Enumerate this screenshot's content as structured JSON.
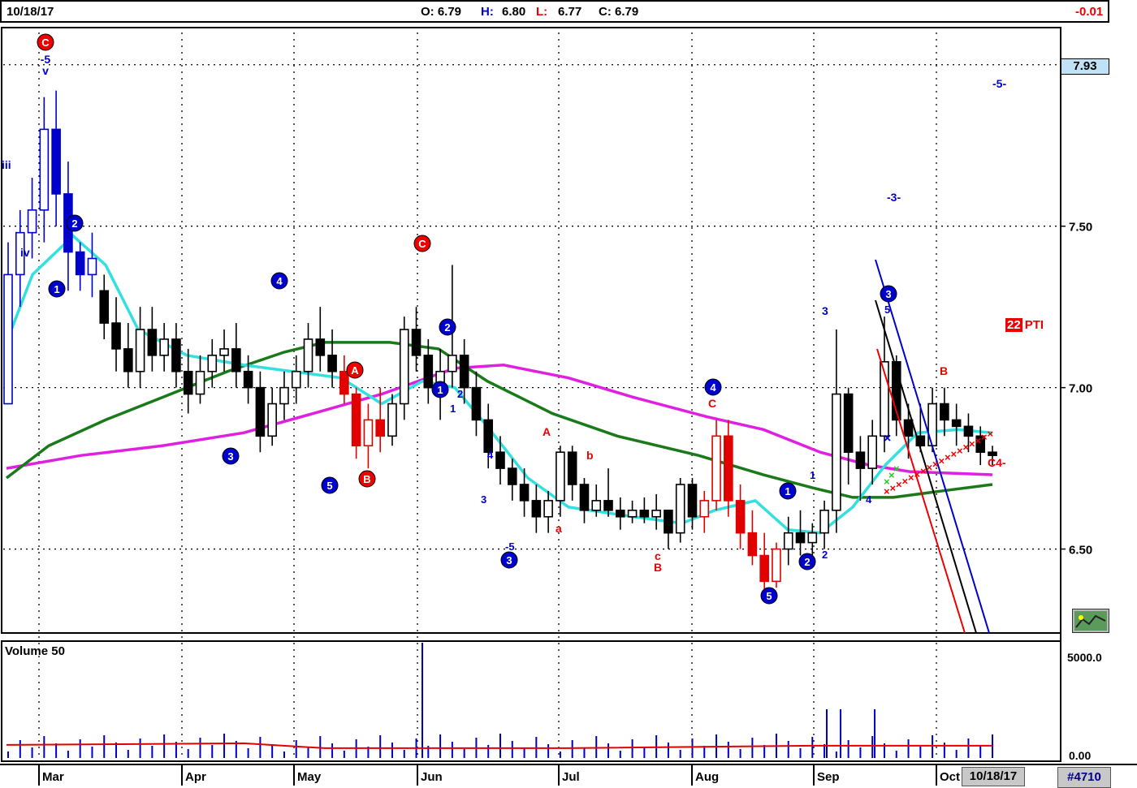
{
  "header": {
    "date": "10/18/17",
    "open": "O: 6.79",
    "high_label": "H:",
    "high_val": "6.80",
    "low_label": "L:",
    "low_val": "6.77",
    "close": "C: 6.79",
    "change": "-0.01"
  },
  "volume_label": "Volume 50",
  "current_price_tag": "7.93",
  "pti": {
    "value": "22",
    "label": "PTI"
  },
  "footer": {
    "date": "10/18/17",
    "symbol_id": "#4710"
  },
  "months": [
    "Mar",
    "Apr",
    "May",
    "Jun",
    "Jul",
    "Aug",
    "Sep",
    "Oct"
  ],
  "colors": {
    "up_wave": "#0000cc",
    "down_wave": "#e00000",
    "ma_fast": "#33e0e0",
    "ma_mid": "#1a7a1a",
    "ma_slow": "#e020e0",
    "volume_ma": "#e00000"
  },
  "chart_data": {
    "type": "candlestick",
    "y_ticks": [
      "8.00",
      "7.50",
      "7.00",
      "6.50"
    ],
    "ylim": [
      6.24,
      8.1
    ],
    "volume_ticks": [
      "5000.0",
      "0.00"
    ],
    "grid": "dotted horizontal and vertical",
    "wave_labels": [
      {
        "text": "-5",
        "color": "blue"
      },
      {
        "text": "v",
        "color": "blue"
      },
      {
        "text": "iii",
        "color": "blue"
      },
      {
        "text": "iv",
        "color": "blue"
      },
      {
        "text": "1",
        "color": "blue",
        "circled": true
      },
      {
        "text": "2",
        "color": "blue",
        "circled": true
      },
      {
        "text": "3",
        "color": "blue",
        "circled": true
      },
      {
        "text": "4",
        "color": "blue",
        "circled": true
      },
      {
        "text": "5",
        "color": "blue",
        "circled": true
      },
      {
        "text": "C",
        "color": "red",
        "circled": true
      },
      {
        "text": "A",
        "color": "red",
        "circled": true
      },
      {
        "text": "B",
        "color": "red",
        "circled": true
      },
      {
        "text": "-3-",
        "color": "blue"
      },
      {
        "text": "-5-",
        "color": "blue"
      },
      {
        "text": "C4-",
        "color": "red"
      }
    ],
    "candles": [
      [
        6.95,
        7.45,
        7.22,
        7.35
      ],
      [
        7.35,
        7.55,
        7.25,
        7.48
      ],
      [
        7.48,
        7.65,
        7.4,
        7.55
      ],
      [
        7.55,
        7.9,
        7.45,
        7.8
      ],
      [
        7.8,
        7.92,
        7.5,
        7.6
      ],
      [
        7.6,
        7.7,
        7.3,
        7.42
      ],
      [
        7.42,
        7.45,
        7.3,
        7.35
      ],
      [
        7.35,
        7.48,
        7.28,
        7.4
      ],
      [
        7.3,
        7.35,
        7.15,
        7.2
      ],
      [
        7.2,
        7.28,
        7.05,
        7.12
      ],
      [
        7.12,
        7.2,
        7.0,
        7.05
      ],
      [
        7.05,
        7.25,
        7.0,
        7.18
      ],
      [
        7.18,
        7.25,
        7.05,
        7.1
      ],
      [
        7.1,
        7.2,
        7.05,
        7.15
      ],
      [
        7.15,
        7.2,
        7.0,
        7.05
      ],
      [
        7.05,
        7.12,
        6.92,
        6.98
      ],
      [
        6.98,
        7.1,
        6.95,
        7.05
      ],
      [
        7.05,
        7.15,
        7.0,
        7.1
      ],
      [
        7.1,
        7.18,
        7.05,
        7.12
      ],
      [
        7.12,
        7.2,
        7.0,
        7.05
      ],
      [
        7.05,
        7.1,
        6.95,
        7.0
      ],
      [
        7.0,
        7.05,
        6.8,
        6.85
      ],
      [
        6.85,
        7.0,
        6.82,
        6.95
      ],
      [
        6.95,
        7.05,
        6.9,
        7.0
      ],
      [
        7.0,
        7.1,
        6.95,
        7.05
      ],
      [
        7.05,
        7.2,
        7.0,
        7.15
      ],
      [
        7.15,
        7.25,
        7.05,
        7.1
      ],
      [
        7.1,
        7.18,
        7.0,
        7.05
      ],
      [
        7.05,
        7.1,
        6.95,
        6.98
      ],
      [
        6.98,
        7.0,
        6.78,
        6.82
      ],
      [
        6.82,
        6.95,
        6.75,
        6.9
      ],
      [
        6.9,
        7.0,
        6.8,
        6.85
      ],
      [
        6.85,
        6.98,
        6.82,
        6.95
      ],
      [
        6.95,
        7.22,
        6.9,
        7.18
      ],
      [
        7.18,
        7.25,
        7.05,
        7.1
      ],
      [
        7.1,
        7.15,
        6.95,
        7.0
      ],
      [
        7.0,
        7.12,
        6.9,
        7.05
      ],
      [
        7.05,
        7.38,
        7.0,
        7.1
      ],
      [
        7.1,
        7.15,
        6.95,
        7.0
      ],
      [
        7.0,
        7.05,
        6.85,
        6.9
      ],
      [
        6.9,
        6.95,
        6.75,
        6.8
      ],
      [
        6.8,
        6.85,
        6.7,
        6.75
      ],
      [
        6.75,
        6.78,
        6.65,
        6.7
      ],
      [
        6.7,
        6.75,
        6.6,
        6.65
      ],
      [
        6.65,
        6.7,
        6.55,
        6.6
      ],
      [
        6.6,
        6.68,
        6.55,
        6.65
      ],
      [
        6.65,
        6.82,
        6.6,
        6.8
      ],
      [
        6.8,
        6.82,
        6.65,
        6.7
      ],
      [
        6.7,
        6.72,
        6.58,
        6.62
      ],
      [
        6.62,
        6.7,
        6.6,
        6.65
      ],
      [
        6.65,
        6.75,
        6.6,
        6.62
      ],
      [
        6.62,
        6.66,
        6.56,
        6.6
      ],
      [
        6.6,
        6.65,
        6.58,
        6.62
      ],
      [
        6.62,
        6.66,
        6.58,
        6.6
      ],
      [
        6.6,
        6.67,
        6.56,
        6.62
      ],
      [
        6.62,
        6.6,
        6.5,
        6.55
      ],
      [
        6.55,
        6.72,
        6.52,
        6.7
      ],
      [
        6.7,
        6.72,
        6.56,
        6.6
      ],
      [
        6.6,
        6.68,
        6.55,
        6.65
      ],
      [
        6.65,
        6.9,
        6.62,
        6.85
      ],
      [
        6.85,
        6.9,
        6.6,
        6.65
      ],
      [
        6.65,
        6.7,
        6.5,
        6.55
      ],
      [
        6.55,
        6.62,
        6.45,
        6.48
      ],
      [
        6.48,
        6.55,
        6.36,
        6.4
      ],
      [
        6.4,
        6.52,
        6.38,
        6.5
      ],
      [
        6.5,
        6.6,
        6.45,
        6.55
      ],
      [
        6.55,
        6.62,
        6.48,
        6.52
      ],
      [
        6.52,
        6.58,
        6.45,
        6.55
      ],
      [
        6.55,
        6.65,
        6.5,
        6.62
      ],
      [
        6.62,
        7.18,
        6.55,
        6.98
      ],
      [
        6.98,
        7.0,
        6.7,
        6.8
      ],
      [
        6.8,
        6.85,
        6.65,
        6.75
      ],
      [
        6.75,
        6.9,
        6.7,
        6.85
      ],
      [
        6.85,
        7.22,
        6.8,
        7.08
      ],
      [
        7.08,
        7.1,
        6.85,
        6.9
      ],
      [
        6.9,
        6.95,
        6.78,
        6.85
      ],
      [
        6.85,
        6.95,
        6.8,
        6.82
      ],
      [
        6.82,
        7.0,
        6.8,
        6.95
      ],
      [
        6.95,
        7.0,
        6.85,
        6.9
      ],
      [
        6.9,
        6.95,
        6.82,
        6.88
      ],
      [
        6.88,
        6.92,
        6.8,
        6.85
      ],
      [
        6.85,
        6.88,
        6.76,
        6.8
      ],
      [
        6.8,
        6.82,
        6.76,
        6.79
      ]
    ],
    "volume_ma_level": 0.12
  }
}
